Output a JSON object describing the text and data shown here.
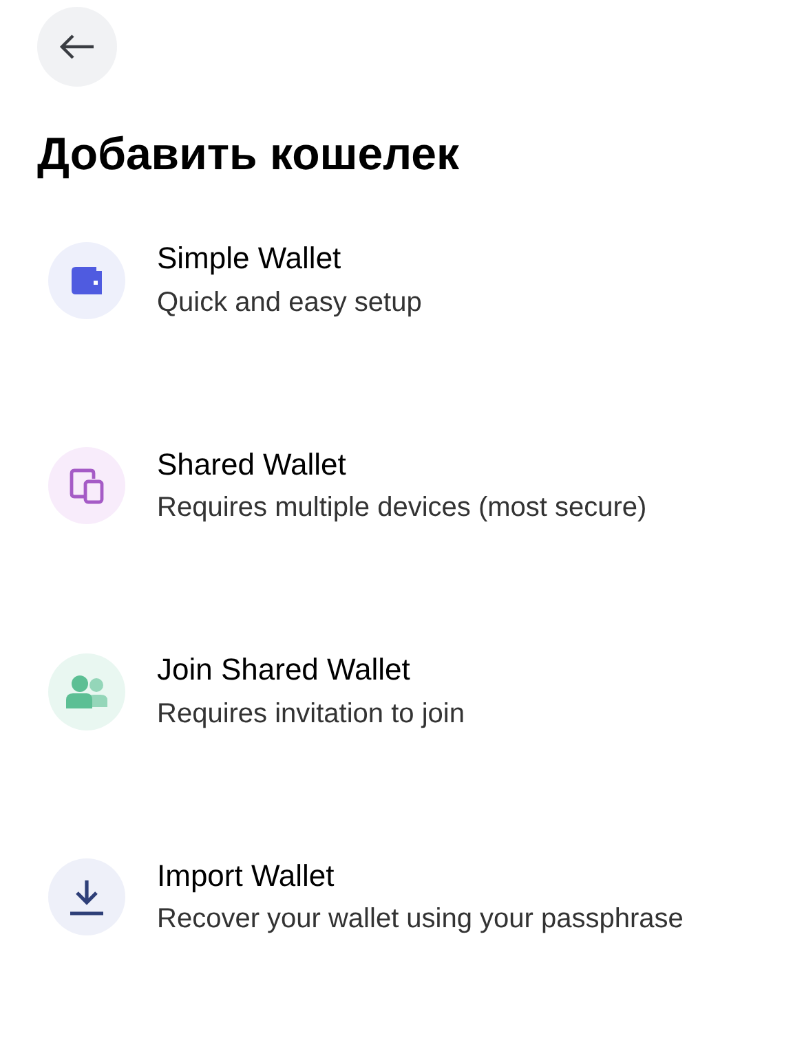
{
  "title": "Добавить кошелек",
  "options": [
    {
      "kind": "wallet",
      "color": "#4f5be0",
      "title": "Simple Wallet",
      "subtitle": "Quick and easy setup"
    },
    {
      "kind": "devices",
      "color": "#a55bc6",
      "title": "Shared Wallet",
      "subtitle": "Requires multiple devices (most secure)"
    },
    {
      "kind": "people",
      "color": "#5cbf94",
      "title": "Join Shared Wallet",
      "subtitle": "Requires invitation to join"
    },
    {
      "kind": "download",
      "color": "#2e3f78",
      "title": "Import Wallet",
      "subtitle": "Recover your wallet using your passphrase"
    }
  ]
}
